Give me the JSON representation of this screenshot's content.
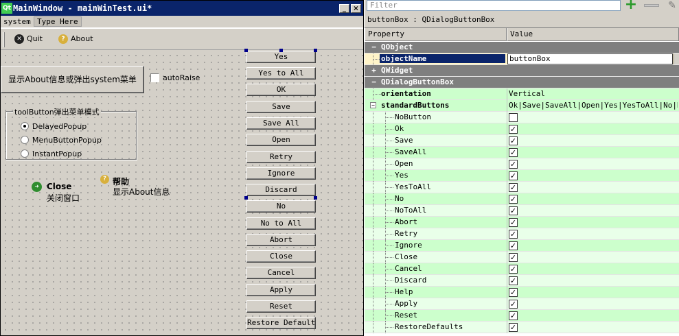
{
  "form_window": {
    "logo": "Qt",
    "title": "MainWindow - mainWinTest.ui*",
    "minimize_glyph": "_",
    "close_glyph": "×",
    "menu": [
      "system",
      "Type Here"
    ],
    "toolbar": {
      "quit_label": "Quit",
      "quit_icon": "quit-icon",
      "about_label": "About",
      "about_icon": "help-icon"
    },
    "widgets": {
      "about_button_label": "显示About信息或弹出system菜单",
      "autoraise_label": "autoRaise",
      "popup_group_title": "toolButton弹出菜单模式",
      "popup_modes": [
        {
          "label": "DelayedPopup",
          "checked": true
        },
        {
          "label": "MenuButtonPopup",
          "checked": false
        },
        {
          "label": "InstantPopup",
          "checked": false
        }
      ],
      "close_tool": {
        "title": "Close",
        "desc": "关闭窗口"
      },
      "help_tool": {
        "title": "帮助",
        "desc": "显示About信息"
      }
    },
    "dialog_buttons": [
      "Yes",
      "Yes to All",
      "OK",
      "Save",
      "Save All",
      "Open",
      "Retry",
      "Ignore",
      "Discard",
      "No",
      "No to All",
      "Abort",
      "Close",
      "Cancel",
      "Apply",
      "Reset",
      "Restore Defaults"
    ]
  },
  "property_editor": {
    "filter_placeholder": "Filter",
    "object_caption": "buttonBox : QDialogButtonBox",
    "headers": {
      "property": "Property",
      "value": "Value"
    },
    "groups": {
      "qobject": "QObject",
      "qwidget": "QWidget",
      "qdialogbuttonbox": "QDialogButtonBox"
    },
    "object_name_label": "objectName",
    "object_name_value": "buttonBox",
    "orientation_label": "orientation",
    "orientation_value": "Vertical",
    "standard_buttons_label": "standardButtons",
    "standard_buttons_value": "Ok|Save|SaveAll|Open|Yes|YesToAll|No|NoT…",
    "flags": [
      {
        "name": "NoButton",
        "checked": false
      },
      {
        "name": "Ok",
        "checked": true
      },
      {
        "name": "Save",
        "checked": true
      },
      {
        "name": "SaveAll",
        "checked": true
      },
      {
        "name": "Open",
        "checked": true
      },
      {
        "name": "Yes",
        "checked": true
      },
      {
        "name": "YesToAll",
        "checked": true
      },
      {
        "name": "No",
        "checked": true
      },
      {
        "name": "NoToAll",
        "checked": true
      },
      {
        "name": "Abort",
        "checked": true
      },
      {
        "name": "Retry",
        "checked": true
      },
      {
        "name": "Ignore",
        "checked": true
      },
      {
        "name": "Close",
        "checked": true
      },
      {
        "name": "Cancel",
        "checked": true
      },
      {
        "name": "Discard",
        "checked": true
      },
      {
        "name": "Help",
        "checked": true
      },
      {
        "name": "Apply",
        "checked": true
      },
      {
        "name": "Reset",
        "checked": true
      },
      {
        "name": "RestoreDefaults",
        "checked": true
      }
    ]
  }
}
